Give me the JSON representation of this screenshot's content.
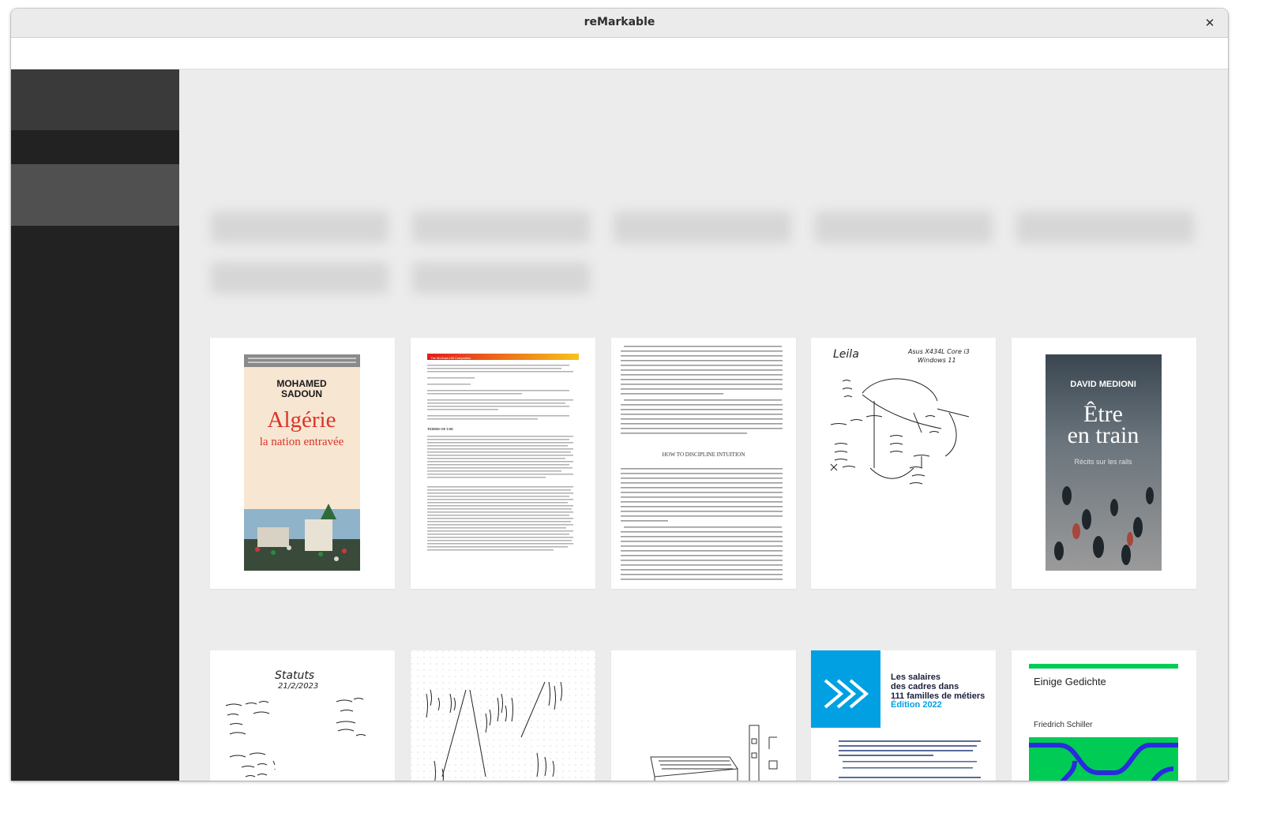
{
  "window": {
    "title": "reMarkable"
  },
  "documents": [
    {
      "cover_text": [
        "MOHAMED",
        "SADOUN",
        "Algérie",
        "la nation entravée"
      ]
    },
    {
      "cover_text": [
        "The McGraw-Hill Companies",
        "TERMS OF USE"
      ]
    },
    {
      "cover_text": [
        "HOW TO DISCIPLINE INTUITION"
      ]
    },
    {
      "cover_text": [
        "Leila",
        "Asus X434L  Core i3",
        "Windows 11"
      ]
    },
    {
      "cover_text": [
        "DAVID MEDIONI",
        "Être",
        "en train",
        "Récits sur les rails"
      ]
    },
    {
      "cover_text": [
        "Statuts",
        "21/2/2023"
      ]
    },
    {
      "cover_text": []
    },
    {
      "cover_text": []
    },
    {
      "cover_text": [
        "Les salaires",
        "des cadres dans",
        "111 familles de métiers",
        "Édition 2022"
      ]
    },
    {
      "cover_text": [
        "Einige Gedichte",
        "Friedrich Schiller"
      ]
    }
  ],
  "colors": {
    "sidebar": "#222222",
    "sidebar_selected": "#505050",
    "main_bg": "#ececec",
    "apec_blue": "#00a0e3",
    "schiller_green": "#00cc55"
  }
}
